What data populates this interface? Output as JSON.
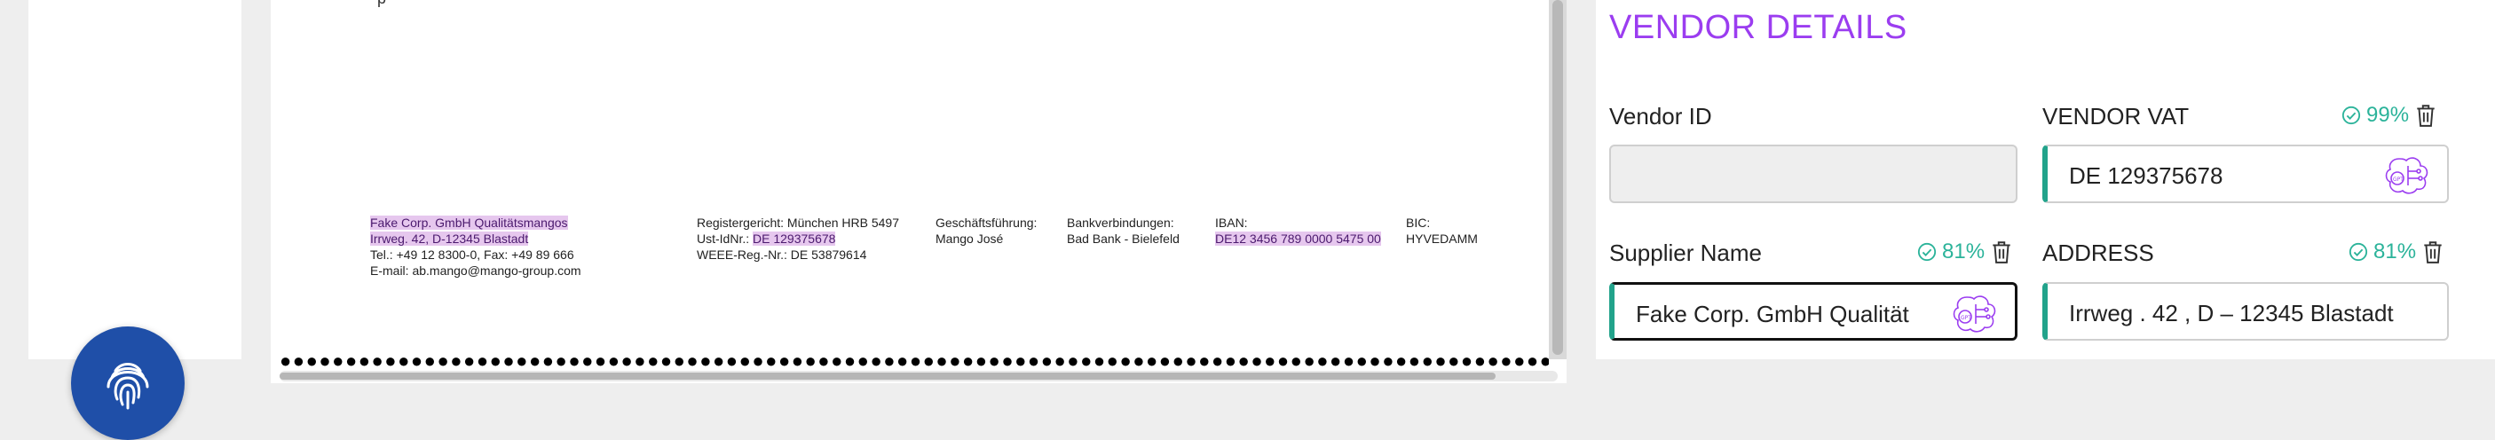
{
  "colors": {
    "accent_purple": "#9b3df0",
    "confidence_teal": "#2bb39a",
    "fab_blue": "#1f4fa8",
    "highlight": "#e6c7ee"
  },
  "fab": {
    "icon": "fingerprint-icon"
  },
  "document": {
    "footer": {
      "company_name": "Fake Corp. GmbH Qualitätsmangos",
      "company_street": "Irrweg. 42, D-12345 Blastadt",
      "company_phone": "Tel.: +49 12 8300-0, Fax: +49 89 666",
      "company_email": "E-mail: ab.mango@mango-group.com",
      "register": "Registergericht: München HRB 5497",
      "ust_label": "Ust-IdNr.:",
      "ust_value": "DE 129375678",
      "weee": "WEEE-Reg.-Nr.: DE 53879614",
      "mgmt_label": "Geschäftsführung:",
      "mgmt_name": "Mango José",
      "bank_label": "Bankverbindungen:",
      "bank_name": "Bad Bank - Bielefeld",
      "iban_label": "IBAN:",
      "iban_value": "DE12 3456 789 0000 5475 00",
      "bic_label": "BIC:",
      "bic_value": "HYVEDAMM"
    }
  },
  "vendor_details": {
    "title": "VENDOR DETAILS",
    "vendor_id": {
      "label": "Vendor ID",
      "value": ""
    },
    "vendor_vat": {
      "label": "VENDOR VAT",
      "confidence": "99%",
      "value": "DE 129375678"
    },
    "supplier_name": {
      "label": "Supplier Name",
      "confidence": "81%",
      "value": "Fake Corp. GmbH Qualität"
    },
    "address": {
      "label": "ADDRESS",
      "confidence": "81%",
      "value": "Irrweg . 42 , D – 12345 Blastadt"
    }
  }
}
